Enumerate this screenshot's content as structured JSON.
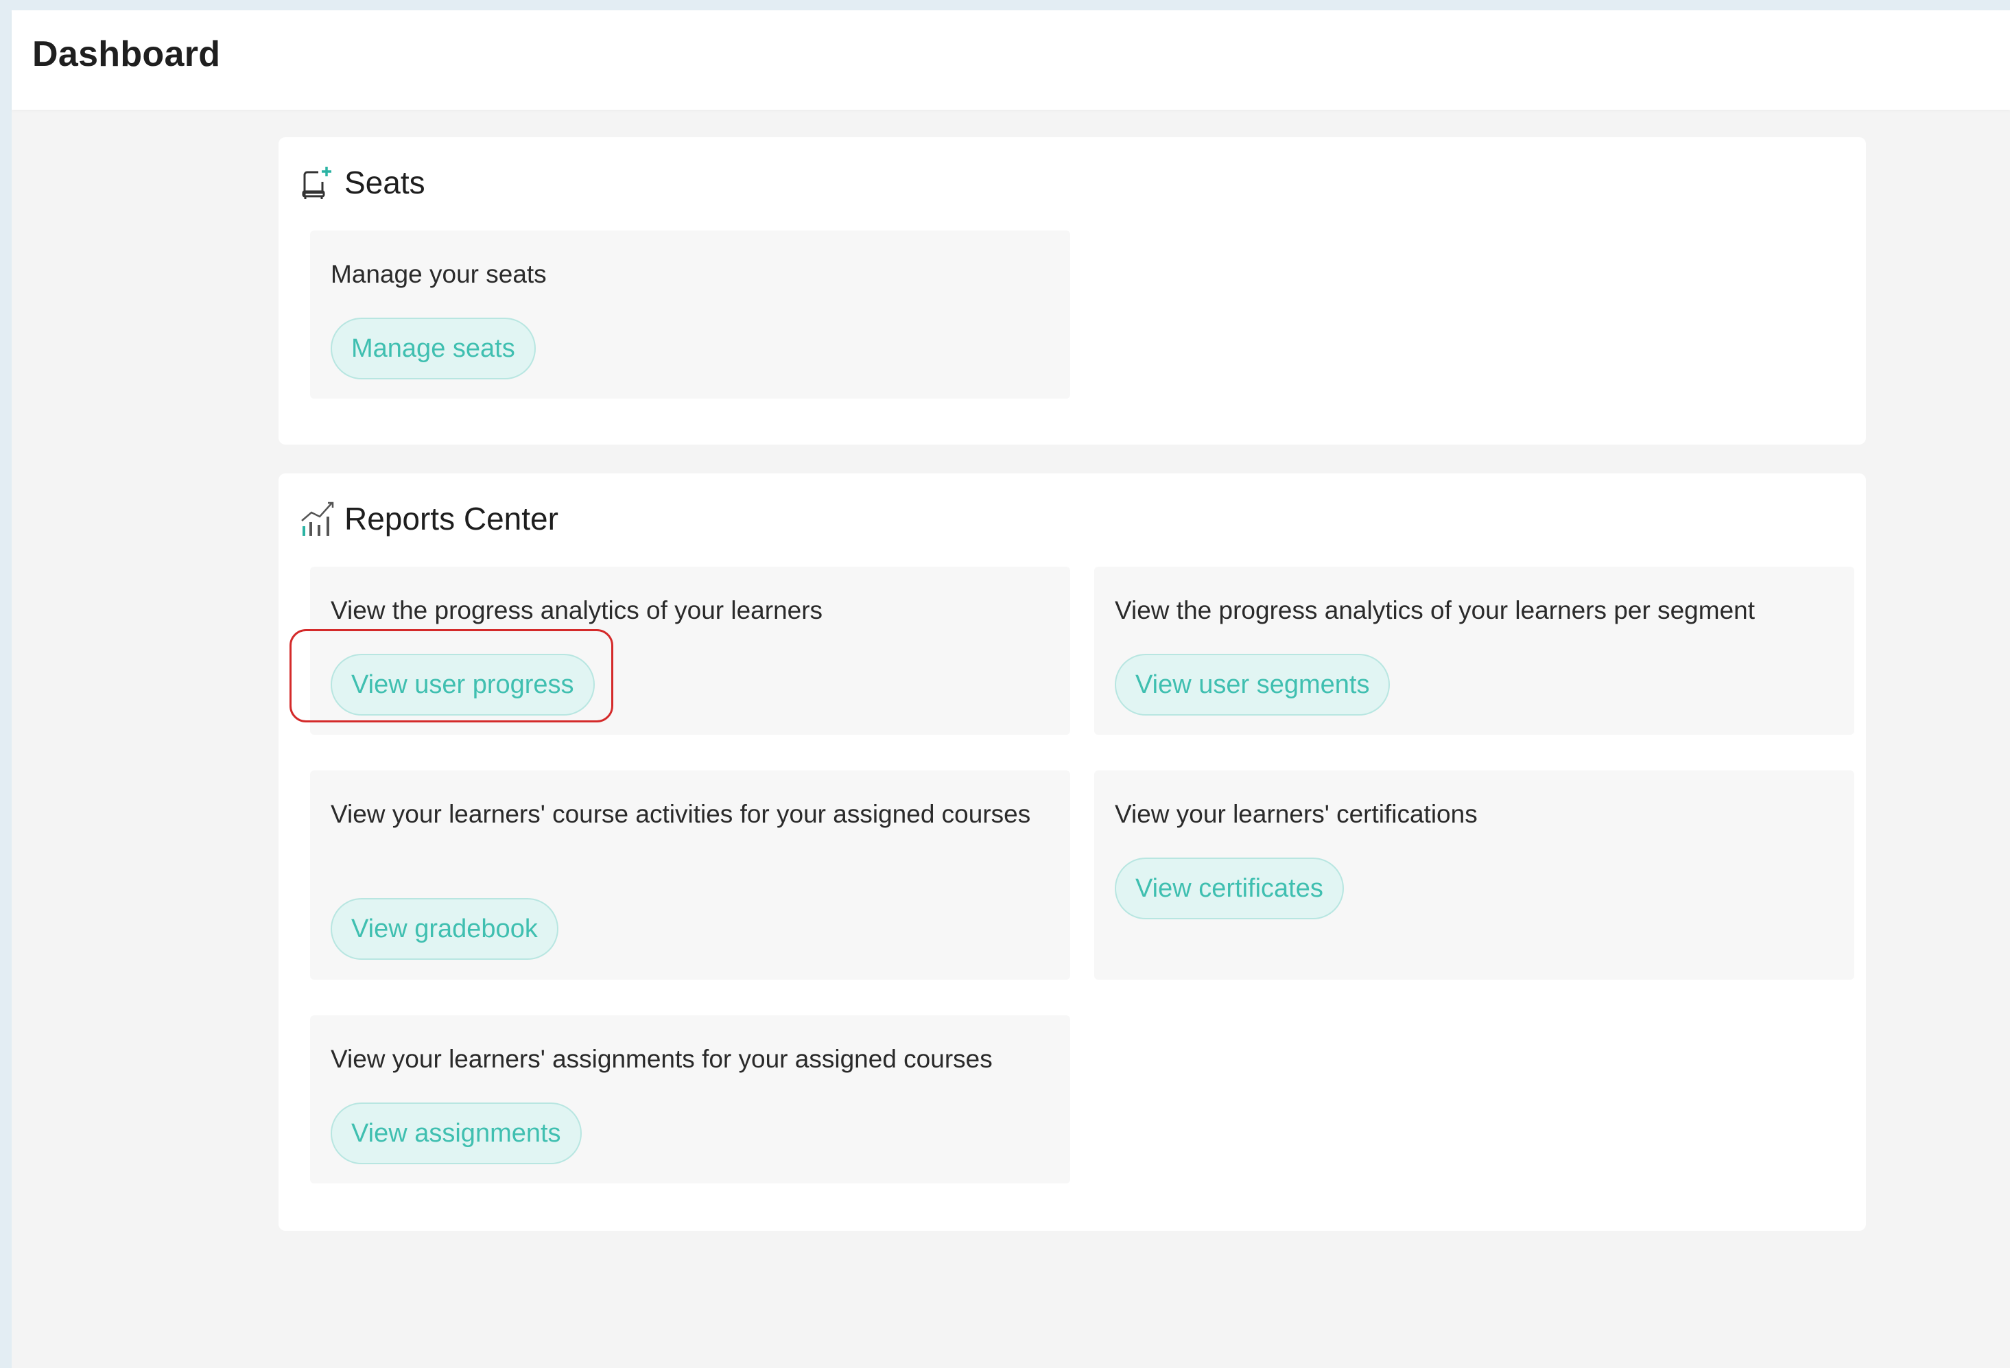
{
  "header": {
    "title": "Dashboard"
  },
  "seats": {
    "title": "Seats",
    "icon": "seat-add-icon",
    "cards": [
      {
        "description": "Manage your seats",
        "button": "Manage seats"
      }
    ]
  },
  "reports": {
    "title": "Reports Center",
    "icon": "bar-chart-trend-icon",
    "cards": [
      {
        "description": "View the progress analytics of your learners",
        "button": "View user progress"
      },
      {
        "description": "View the progress analytics of your learners per segment",
        "button": "View user segments"
      },
      {
        "description": "View your learners' course activities for your assigned courses",
        "button": "View gradebook"
      },
      {
        "description": "View your learners' certifications",
        "button": "View certificates"
      },
      {
        "description": "View your learners' assignments for your assigned courses",
        "button": "View assignments"
      }
    ]
  },
  "colors": {
    "accent_text": "#3fbfb0",
    "accent_bg": "#e1f5f3",
    "highlight": "#d42a2a"
  }
}
